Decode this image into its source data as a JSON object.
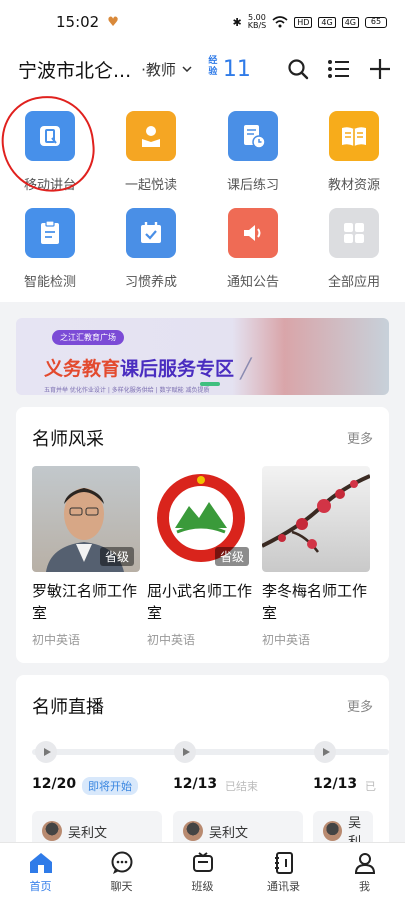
{
  "status": {
    "time": "15:02",
    "net_speed_top": "5.00",
    "net_speed_bottom": "KB/S",
    "hd_label": "HD",
    "sig1": "4G",
    "sig2": "4G",
    "battery": "65"
  },
  "header": {
    "org": "宁波市北仑...",
    "role": "·教师",
    "xp_badge": "经验",
    "xp_value": "11"
  },
  "apps": [
    {
      "label": "移动讲台",
      "color": "#4790ea"
    },
    {
      "label": "一起悦读",
      "color": "#f5a623"
    },
    {
      "label": "课后练习",
      "color": "#4a8fe6"
    },
    {
      "label": "教材资源",
      "color": "#f7ac1b"
    },
    {
      "label": "智能检测",
      "color": "#4790ea"
    },
    {
      "label": "习惯养成",
      "color": "#4a8fe6"
    },
    {
      "label": "通知公告",
      "color": "#ef6b55"
    },
    {
      "label": "全部应用",
      "color": "#dcdde0"
    }
  ],
  "banner": {
    "tag": "之江汇教育广场",
    "title_a": "义务教育",
    "title_b": "课后服务专区",
    "sub": "五育并举 优化作业设计 | 多样化服务供给 | 数字赋能 减负提质"
  },
  "teachers": {
    "title": "名师风采",
    "more": "更多",
    "items": [
      {
        "name": "罗敏江名师工作室",
        "level": "省级",
        "subject": "初中英语"
      },
      {
        "name": "屈小武名师工作室",
        "level": "省级",
        "subject": "初中英语"
      },
      {
        "name": "李冬梅名师工作室",
        "level": "",
        "subject": "初中英语"
      }
    ]
  },
  "live": {
    "title": "名师直播",
    "more": "更多",
    "items": [
      {
        "date": "12/20",
        "status": "即将开始",
        "teacher": "吴利文"
      },
      {
        "date": "12/13",
        "status": "已结束",
        "teacher": "吴利文"
      },
      {
        "date": "12/13",
        "status": "已",
        "teacher": "吴利"
      }
    ]
  },
  "tabs": [
    {
      "label": "首页",
      "active": true
    },
    {
      "label": "聊天",
      "active": false
    },
    {
      "label": "班级",
      "active": false
    },
    {
      "label": "通讯录",
      "active": false
    },
    {
      "label": "我",
      "active": false
    }
  ]
}
